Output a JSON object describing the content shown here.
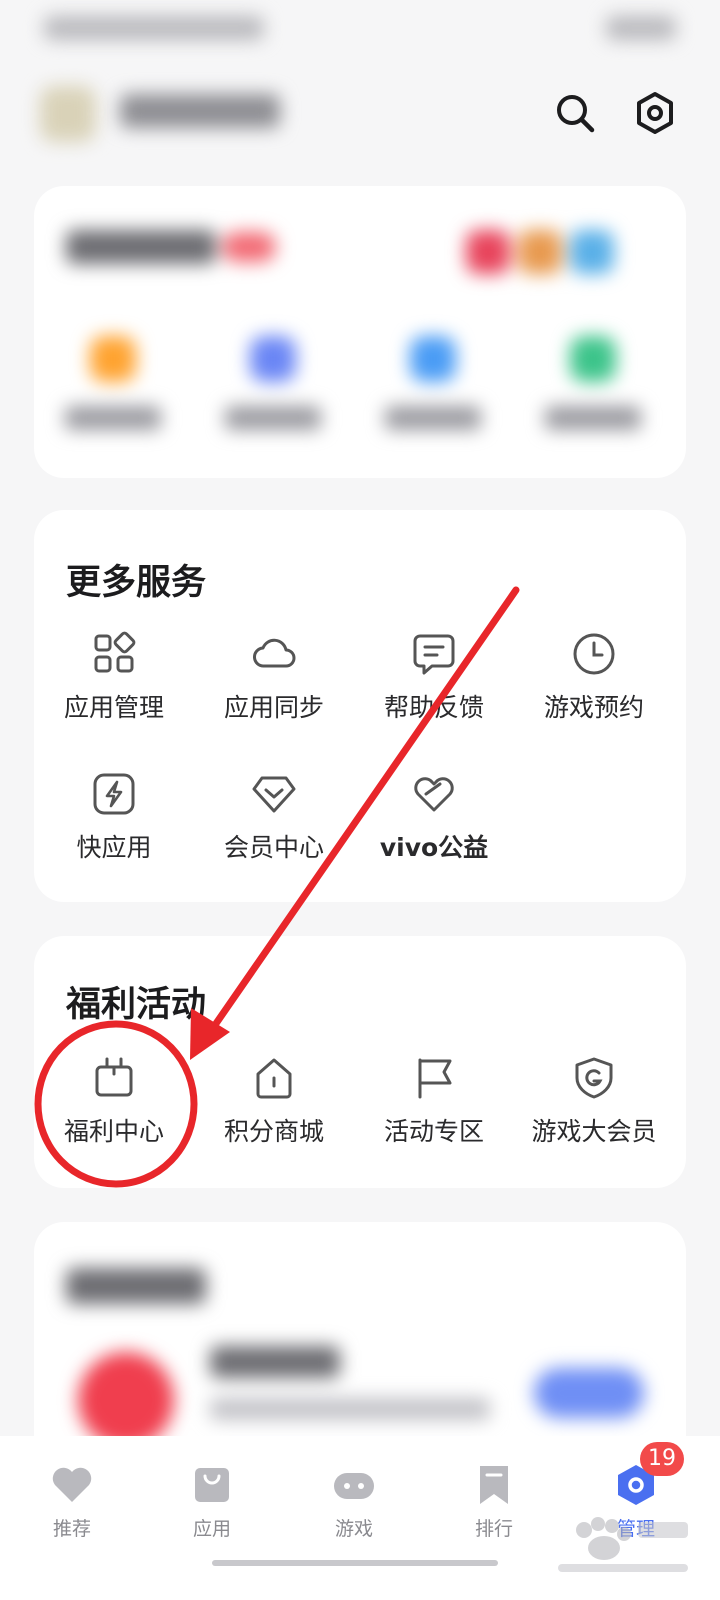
{
  "more_services": {
    "title": "更多服务",
    "items": [
      {
        "label": "应用管理",
        "icon": "grid-apps-icon"
      },
      {
        "label": "应用同步",
        "icon": "cloud-sync-icon"
      },
      {
        "label": "帮助反馈",
        "icon": "chat-feedback-icon"
      },
      {
        "label": "游戏预约",
        "icon": "clock-icon"
      },
      {
        "label": "快应用",
        "icon": "quick-app-bolt-icon"
      },
      {
        "label": "会员中心",
        "icon": "diamond-member-icon"
      },
      {
        "label": "vivo公益",
        "icon": "charity-heart-icon"
      }
    ]
  },
  "welfare": {
    "title": "福利活动",
    "items": [
      {
        "label": "福利中心",
        "icon": "gift-box-icon"
      },
      {
        "label": "积分商城",
        "icon": "points-shop-icon"
      },
      {
        "label": "活动专区",
        "icon": "flag-icon"
      },
      {
        "label": "游戏大会员",
        "icon": "game-shield-icon"
      }
    ]
  },
  "bottom_nav": {
    "items": [
      {
        "label": "推荐",
        "icon": "heart-icon"
      },
      {
        "label": "应用",
        "icon": "shopping-bag-icon"
      },
      {
        "label": "游戏",
        "icon": "gamepad-icon"
      },
      {
        "label": "排行",
        "icon": "bookmark-icon"
      },
      {
        "label": "管理",
        "icon": "manage-gear-icon"
      }
    ],
    "active": "管理",
    "manage_badge": "19"
  },
  "colors": {
    "accent_blue": "#4a6ff0",
    "badge_red": "#f24a4a",
    "annotation_red": "#e8262a"
  }
}
